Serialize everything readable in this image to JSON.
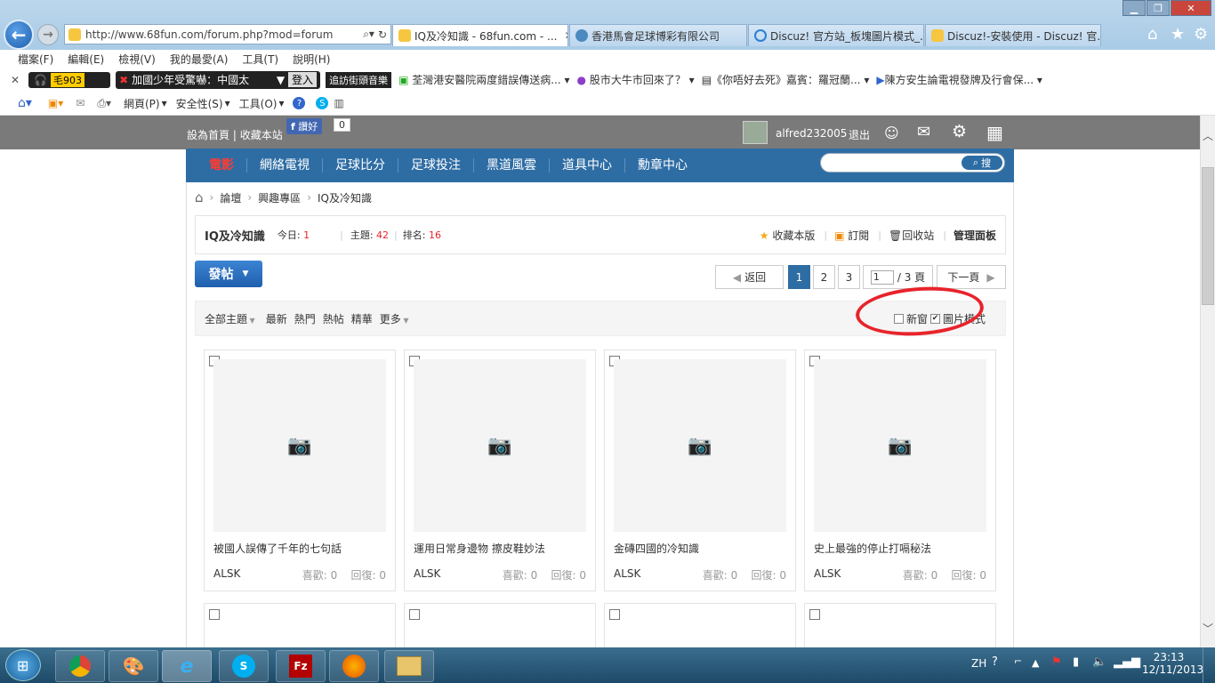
{
  "browser": {
    "url": "http://www.68fun.com/forum.php?mod=forum",
    "tabs": [
      {
        "label": "IQ及冷知識 - 68fun.com - ...",
        "active": true
      },
      {
        "label": "香港馬會足球博彩有限公司",
        "active": false
      },
      {
        "label": "Discuz! 官方站_板塊圖片模式_...",
        "active": false
      },
      {
        "label": "Discuz!-安裝使用 - Discuz! 官...",
        "active": false
      }
    ],
    "menu": [
      "檔案(F)",
      "編輯(E)",
      "檢視(V)",
      "我的最愛(A)",
      "工具(T)",
      "說明(H)"
    ],
    "favbar": {
      "close": "✕",
      "toolbar_count": "毛903",
      "news_ticker": "加國少年受驚嚇：中國太",
      "login": "登入",
      "music": "追訪街頭音樂",
      "items": [
        "荃灣港安醫院兩度錯誤傳送病...",
        "股市大牛市回來了？",
        "《你唔好去死》嘉賓：羅冠蘭...",
        "陳方安生論電視發牌及行會保..."
      ]
    },
    "cmdbar": [
      "網頁(P)",
      "安全性(S)",
      "工具(O)"
    ]
  },
  "site": {
    "top_links": [
      "設為首頁",
      "收藏本站"
    ],
    "fb_like": "讚好",
    "fb_count": "0",
    "username": "alfred232005",
    "logout": "退出",
    "nav": [
      "電影",
      "網絡電視",
      "足球比分",
      "足球投注",
      "黑道風雲",
      "道具中心",
      "勳章中心"
    ],
    "search_btn": "搜",
    "breadcrumb": [
      "論壇",
      "興趣專區",
      "IQ及冷知識"
    ],
    "forum": {
      "name": "IQ及冷知識",
      "today_label": "今日:",
      "today": "1",
      "threads_label": "主題:",
      "threads": "42",
      "rank_label": "排名:",
      "rank": "16",
      "actions": [
        "收藏本版",
        "訂閱",
        "回收站",
        "管理面板"
      ]
    },
    "post_btn": "發帖",
    "pager": {
      "back": "返回",
      "pages": [
        "1",
        "2",
        "3"
      ],
      "current": "1",
      "input": "1",
      "total": "/ 3 頁",
      "next": "下一頁"
    },
    "filters": [
      "全部主題",
      "最新",
      "熱門",
      "熱帖",
      "精華",
      "更多"
    ],
    "view_opts": {
      "new_window": "新窗",
      "picture_mode": "圖片模式"
    },
    "cards": [
      {
        "title": "被國人誤傳了千年的七句話",
        "author": "ALSK",
        "likes": "喜歡: 0",
        "replies": "回復: 0"
      },
      {
        "title": "運用日常身邊物 擦皮鞋妙法",
        "author": "ALSK",
        "likes": "喜歡: 0",
        "replies": "回復: 0"
      },
      {
        "title": "金磚四國的冷知識",
        "author": "ALSK",
        "likes": "喜歡: 0",
        "replies": "回復: 0"
      },
      {
        "title": "史上最強的停止打嗝秘法",
        "author": "ALSK",
        "likes": "喜歡: 0",
        "replies": "回復: 0"
      }
    ]
  },
  "taskbar": {
    "lang": "ZH",
    "time": "23:13",
    "date": "12/11/2013"
  },
  "colors": {
    "nav": "#2e6da4",
    "highlight": "#e8232b",
    "accent_red": "#e8232b"
  }
}
